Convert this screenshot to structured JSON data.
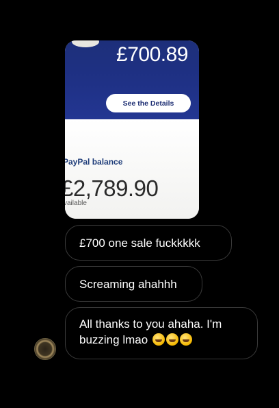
{
  "photo": {
    "amount": "£700.89",
    "button": "See the Details",
    "balance_label": "PayPal balance",
    "balance_amount": "£2,789.90",
    "available": "vailable"
  },
  "messages": [
    {
      "text": "£700 one sale fuckkkkk"
    },
    {
      "text": "Screaming ahahhh"
    },
    {
      "line1": "All thanks to you ahaha. I'm",
      "line2": "buzzing lmao",
      "emojis": [
        "rolling-on-floor-laughing-icon",
        "rolling-on-floor-laughing-icon",
        "rolling-on-floor-laughing-icon"
      ]
    }
  ],
  "colors": {
    "paypal_blue": "#1f3186",
    "bubble_border": "#3a3a3a"
  }
}
